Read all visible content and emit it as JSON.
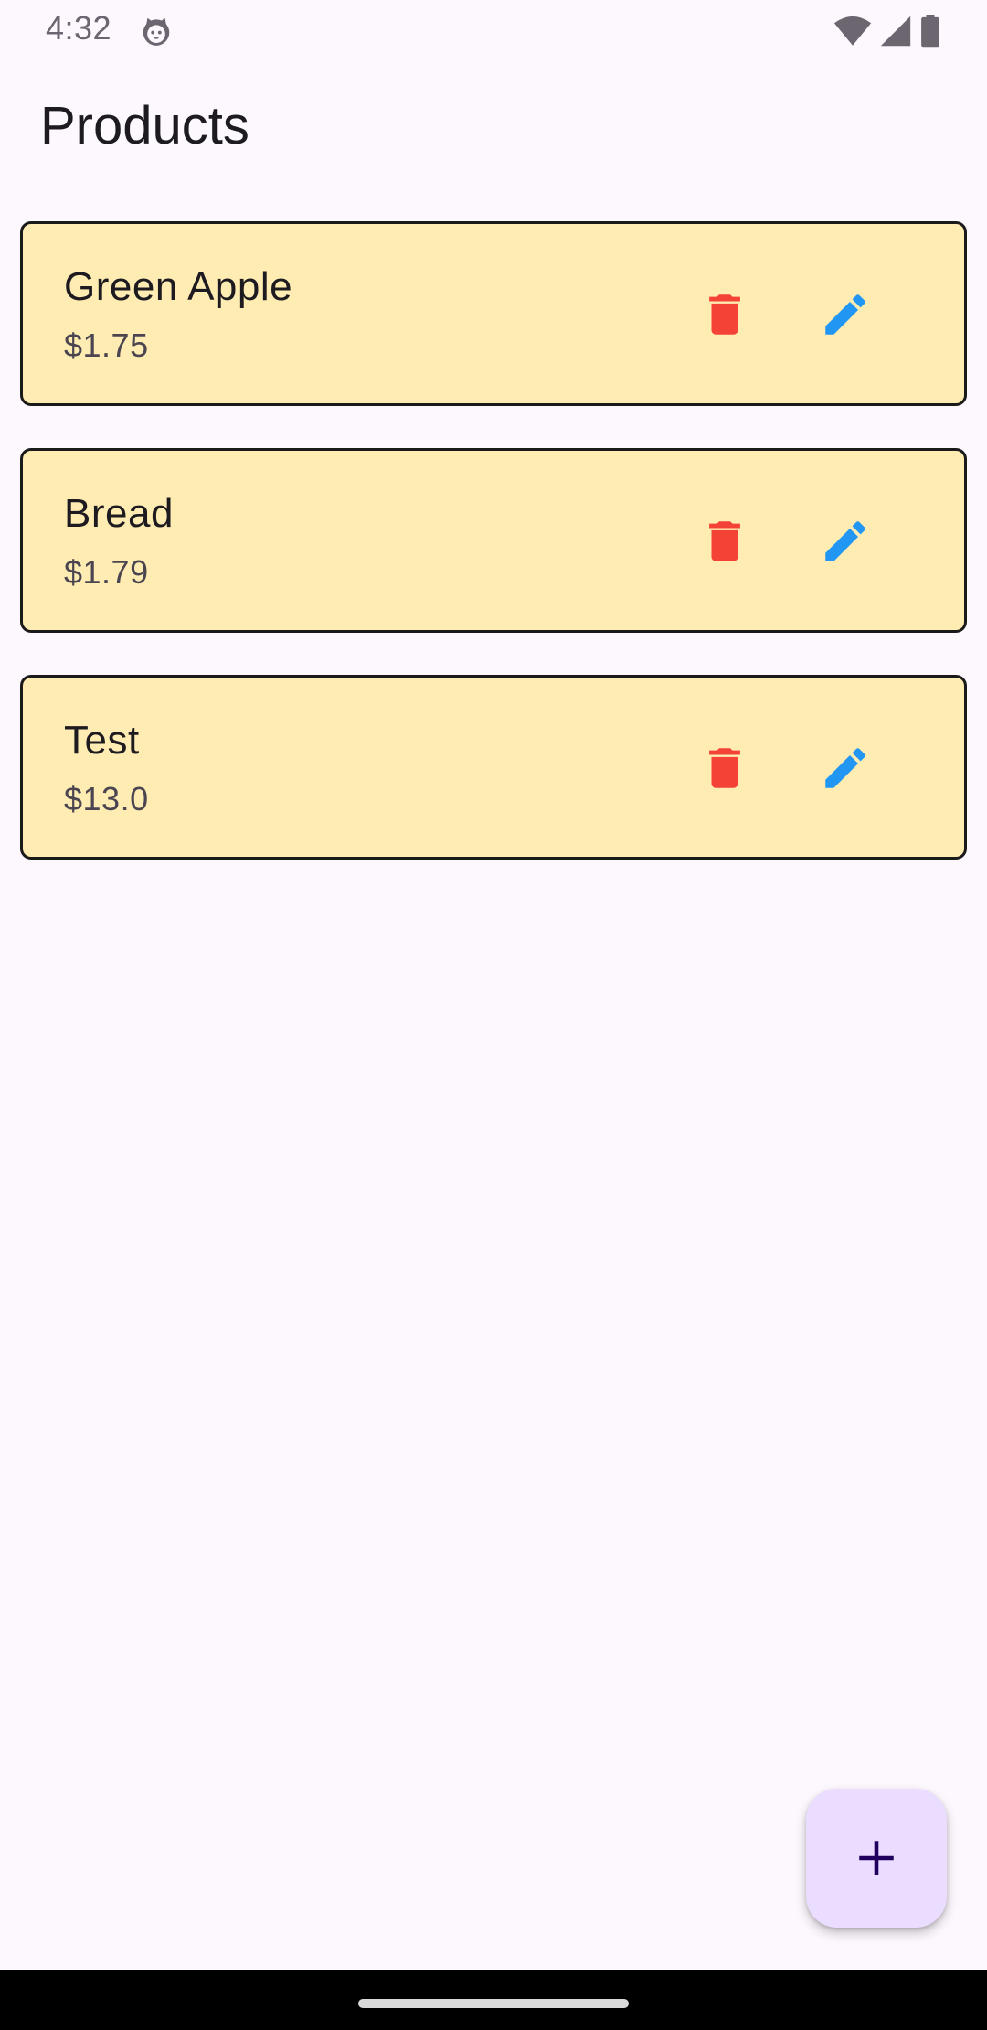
{
  "status_bar": {
    "time": "4:32",
    "icons": [
      "cat-notification-icon",
      "wifi-icon",
      "cellular-signal-icon",
      "battery-icon"
    ]
  },
  "app_bar": {
    "title": "Products"
  },
  "products": [
    {
      "name": "Green Apple",
      "price": "$1.75"
    },
    {
      "name": "Bread",
      "price": "$1.79"
    },
    {
      "name": "Test",
      "price": "$13.0"
    }
  ],
  "icons": {
    "delete": "delete-icon",
    "edit": "edit-icon",
    "add": "add-icon"
  },
  "colors": {
    "background": "#FDF7FE",
    "card_background": "#FFECB3",
    "card_border": "#1A1A1A",
    "delete_icon": "#F44336",
    "edit_icon": "#2196F3",
    "fab_background": "#EADDFF",
    "fab_icon": "#21005D"
  }
}
